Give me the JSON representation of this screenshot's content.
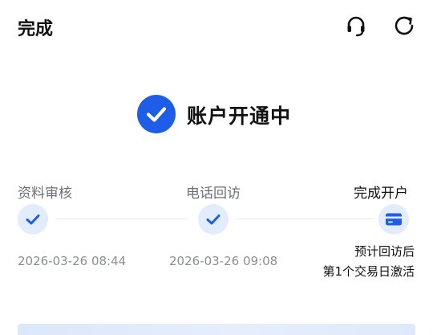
{
  "header": {
    "title": "完成",
    "support_icon": "headset-icon",
    "refresh_icon": "refresh-icon"
  },
  "status": {
    "icon": "check-circle-icon",
    "title": "账户开通中"
  },
  "steps": [
    {
      "label": "资料审核",
      "time": "2026-03-26 08:44",
      "state": "done"
    },
    {
      "label": "电话回访",
      "time": "2026-03-26 09:08",
      "state": "done"
    },
    {
      "label": "完成开户",
      "note_line1": "预计回访后",
      "note_line2": "第1个交易日激活",
      "state": "current"
    }
  ],
  "colors": {
    "accent": "#1e5de8",
    "step_dot_bg": "#e3ecfd",
    "muted_text": "#6b6f78"
  }
}
